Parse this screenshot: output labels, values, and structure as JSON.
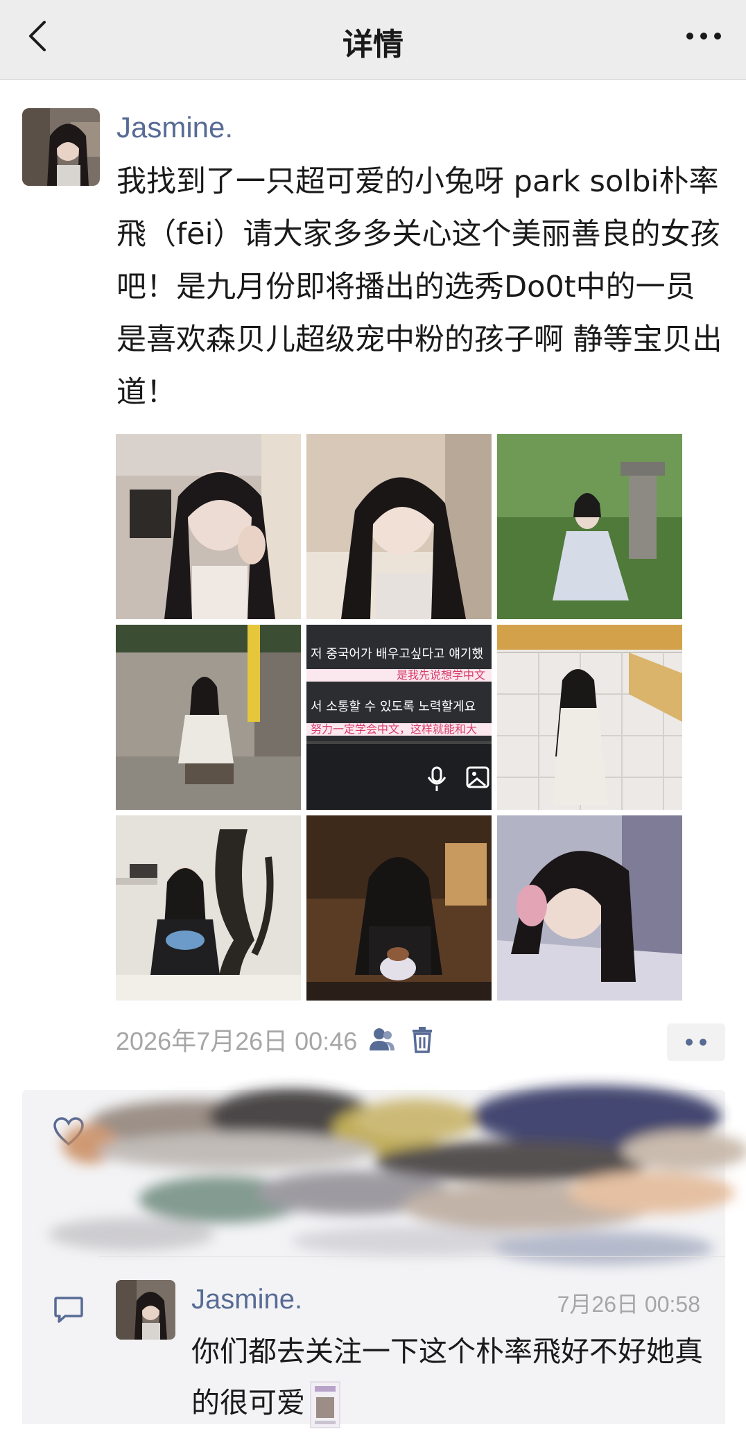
{
  "header": {
    "title": "详情",
    "back_icon": "chevron-left-icon",
    "more_icon": "more-horizontal-icon"
  },
  "post": {
    "author": "Jasmine.",
    "text": "我找到了一只超可爱的小兔呀 park solbi朴率飛（fēi）请大家多多关心这个美丽善良的女孩吧！是九月份即将播出的选秀Do0t中的一员 是喜欢森贝儿超级宠中粉的孩子啊 静等宝贝出道！",
    "photos": [
      {
        "alt": "photo-1"
      },
      {
        "alt": "photo-2"
      },
      {
        "alt": "photo-3"
      },
      {
        "alt": "photo-4"
      },
      {
        "alt": "photo-5"
      },
      {
        "alt": "photo-6"
      },
      {
        "alt": "photo-7"
      },
      {
        "alt": "photo-8"
      },
      {
        "alt": "photo-9"
      }
    ],
    "screenshot_photo_text": {
      "line1": "저 중국어가 배우고싶다고 얘기했",
      "line2": "是我先说想学中文",
      "line3": "서 소통할 수 있도록 노력할게요",
      "line4": "努力一定学会中文，这样就能和大"
    },
    "timestamp": "2026年7月26日 00:46",
    "visibility_icon": "people-icon",
    "delete_icon": "trash-icon",
    "action_icon": "comment-like-menu-icon"
  },
  "interactions": {
    "like_icon": "heart-outline-icon",
    "comment_icon": "speech-bubble-icon",
    "comments": [
      {
        "author": "Jasmine.",
        "time": "7月26日 00:58",
        "text": "你们都去关注一下这个朴率飛好不好她真的很可爱"
      }
    ]
  },
  "colors": {
    "header_bg": "#ededed",
    "name_link": "#576b95",
    "meta_gray": "#a6a6a6",
    "panel_bg": "#f3f3f5"
  }
}
